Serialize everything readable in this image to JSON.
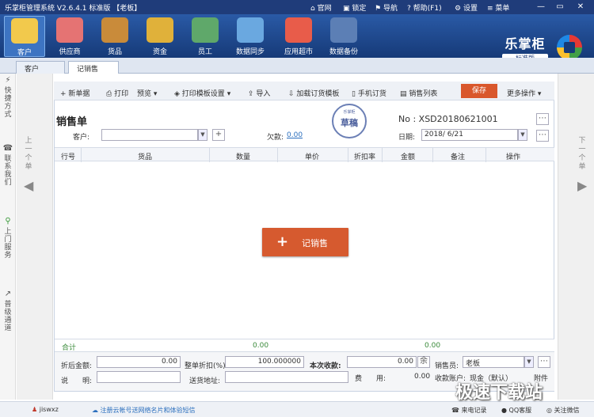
{
  "window": {
    "title": "乐掌柜管理系统 V2.6.4.1 标准版 【老板】",
    "links": [
      "官网",
      "锁定",
      "导航",
      "帮助(F1)",
      "设置",
      "菜单"
    ],
    "buttons": [
      "—",
      "▭",
      "✕"
    ]
  },
  "toolbar": {
    "items": [
      "客户",
      "供应商",
      "货品",
      "资金",
      "员工",
      "数据同步",
      "应用超市",
      "数据备份"
    ],
    "icon_colors": [
      "#f2c94c",
      "#e57373",
      "#c98b3a",
      "#e0b13a",
      "#5fa86a",
      "#6aa8e0",
      "#e85c4a",
      "#5c7fb5"
    ],
    "brand": "乐掌柜",
    "edition": "标准版"
  },
  "tabs": [
    "客户",
    "记销售"
  ],
  "left_side": [
    "快捷方式",
    "联系我们",
    "上门服务",
    "普级通道"
  ],
  "left_icons": [
    "lightning-icon",
    "phone-icon",
    "bike-icon",
    "chart-icon"
  ],
  "prev_label": "上一个单",
  "next_label": "下一个单",
  "actions": {
    "new": "+ 新单据",
    "print": "打印",
    "preview": "预览",
    "template": "打印模板设置",
    "import": "导入",
    "load": "加载订货模板",
    "mobile": "手机订货",
    "list": "销售列表",
    "save": "保存",
    "more": "更多操作"
  },
  "form": {
    "title": "销售单",
    "no_label": "No : XSD20180621001",
    "customer_label": "客户:",
    "customer_value": "",
    "debt_label": "欠款:",
    "debt_value": "0.00",
    "date_label": "日期:",
    "date_value": "2018/ 6/21",
    "stamp_top": "乐掌柜",
    "stamp_main": "草稿"
  },
  "grid": {
    "headers": [
      "行号",
      "货品",
      "数量",
      "单价",
      "折扣率",
      "金额",
      "备注",
      "操作"
    ]
  },
  "big_button": {
    "plus": "+",
    "label": "记销售"
  },
  "totals": {
    "label": "合计",
    "qty": "0.00",
    "amount": "0.00"
  },
  "footer": {
    "after_discount_label": "折后金额:",
    "after_discount": "0.00",
    "whole_discount_label": "整单折扣(%)",
    "whole_discount": "100.000000",
    "receive_label": "本次收款:",
    "receive": "0.00",
    "remain_btn": "余",
    "seller_label": "销售员:",
    "seller": "老板",
    "note_label": "说　　明:",
    "address_label": "送货地址:",
    "fee_label": "费　　用:",
    "fee": "0.00",
    "account_label": "收款账户:",
    "account": "现金（默认）",
    "attach": "附件"
  },
  "status": {
    "user": "jiswxz",
    "promo": "注册云帐号送网络名片和体验短信",
    "call": "来电记录",
    "qq": "QQ客服",
    "wechat": "关注微信"
  },
  "watermark": "极速下载站"
}
